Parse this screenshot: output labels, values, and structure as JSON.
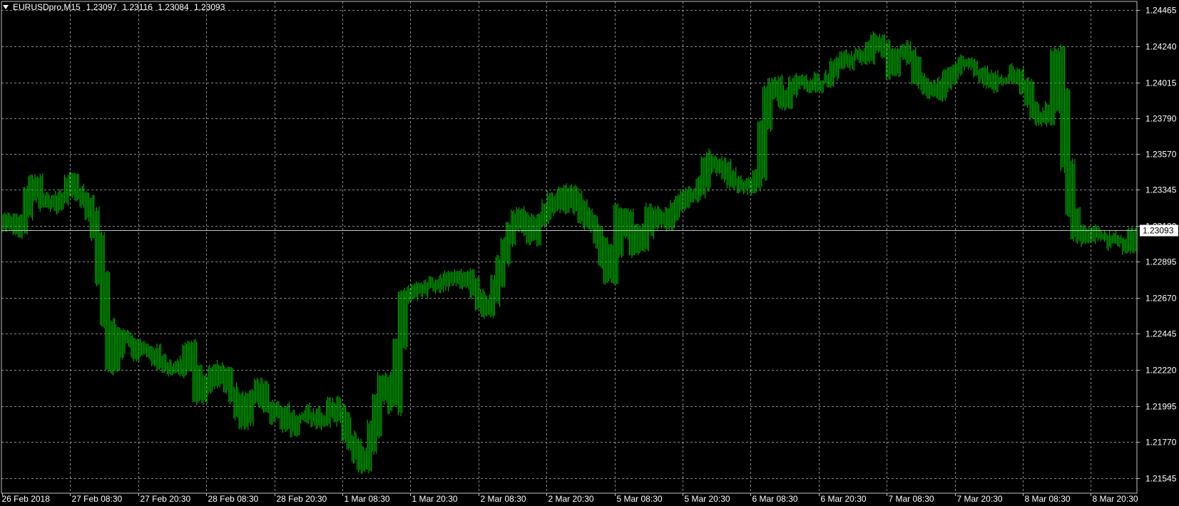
{
  "header": {
    "symbol": "EURUSDpro,M15",
    "open": "1.23097",
    "high": "1.23116",
    "low": "1.23084",
    "close": "1.23093"
  },
  "colors": {
    "background": "#000000",
    "grid": "#c0c0c0",
    "bars": "#00c000",
    "axis_text": "#ffffff",
    "price_line": "#c0c0c0",
    "price_label_bg": "#ffffff",
    "price_label_text": "#000000"
  },
  "chart_data": {
    "type": "line",
    "style": "ohlc-bars",
    "symbol": "EURUSDpro",
    "timeframe": "M15",
    "grid": true,
    "ylim": [
      1.2145,
      1.2452
    ],
    "y_ticks": [
      "1.24465",
      "1.24240",
      "1.24015",
      "1.23790",
      "1.23570",
      "1.23345",
      "1.23120",
      "1.22895",
      "1.22670",
      "1.22445",
      "1.22220",
      "1.21995",
      "1.21770",
      "1.21545"
    ],
    "x_ticks": [
      "26 Feb 2018",
      "27 Feb 08:30",
      "27 Feb 20:30",
      "28 Feb 08:30",
      "28 Feb 20:30",
      "1 Mar 08:30",
      "1 Mar 20:30",
      "2 Mar 08:30",
      "2 Mar 20:30",
      "5 Mar 08:30",
      "5 Mar 20:30",
      "6 Mar 08:30",
      "6 Mar 20:30",
      "7 Mar 08:30",
      "7 Mar 20:30",
      "8 Mar 08:30",
      "8 Mar 20:30"
    ],
    "current_price": 1.23093,
    "current_price_label": "1.23093",
    "series": [
      {
        "values": [
          1.2312,
          1.2316,
          1.2312,
          1.231,
          1.2318,
          1.2335,
          1.234,
          1.233,
          1.2325,
          1.2328,
          1.2325,
          1.233,
          1.2333,
          1.234,
          1.2335,
          1.233,
          1.2328,
          1.2318,
          1.2305,
          1.228,
          1.225,
          1.2225,
          1.2232,
          1.2245,
          1.224,
          1.2238,
          1.2234,
          1.2236,
          1.2235,
          1.2232,
          1.2228,
          1.2226,
          1.2225,
          1.2224,
          1.2222,
          1.2228,
          1.2235,
          1.2222,
          1.2205,
          1.221,
          1.2218,
          1.2222,
          1.2215,
          1.222,
          1.221,
          1.2205,
          1.2195,
          1.219,
          1.2203,
          1.2208,
          1.2212,
          1.22,
          1.2198,
          1.2192,
          1.2195,
          1.2188,
          1.2185,
          1.2192,
          1.219,
          1.2193,
          1.2195,
          1.219,
          1.2193,
          1.2192,
          1.22,
          1.2195,
          1.219,
          1.218,
          1.2175,
          1.2168,
          1.216,
          1.2172,
          1.2185,
          1.2205,
          1.2215,
          1.2215,
          1.22,
          1.224,
          1.2268,
          1.2272,
          1.227,
          1.2272,
          1.2275,
          1.2273,
          1.2275,
          1.2275,
          1.2278,
          1.2278,
          1.228,
          1.2278,
          1.2282,
          1.2275,
          1.227,
          1.2262,
          1.2258,
          1.2265,
          1.2278,
          1.229,
          1.23,
          1.231,
          1.232,
          1.2315,
          1.231,
          1.2305,
          1.2315,
          1.2318,
          1.2322,
          1.2328,
          1.233,
          1.2325,
          1.2335,
          1.233,
          1.2325,
          1.2318,
          1.2315,
          1.231,
          1.2302,
          1.229,
          1.228,
          1.2298,
          1.232,
          1.232,
          1.2308,
          1.2298,
          1.23,
          1.2308,
          1.2322,
          1.2318,
          1.2315,
          1.2315,
          1.232,
          1.2325,
          1.2327,
          1.233,
          1.2332,
          1.2332,
          1.2338,
          1.2355,
          1.2352,
          1.235,
          1.2348,
          1.2345,
          1.234,
          1.2338,
          1.2335,
          1.2335,
          1.2338,
          1.2345,
          1.2375,
          1.2395,
          1.24,
          1.2395,
          1.239,
          1.2395,
          1.24,
          1.2403,
          1.24,
          1.2398,
          1.24,
          1.2402,
          1.2402,
          1.2405,
          1.2412,
          1.2415,
          1.2415,
          1.2417,
          1.2418,
          1.2418,
          1.2418,
          1.2422,
          1.2428,
          1.2425,
          1.2418,
          1.2408,
          1.242,
          1.2422,
          1.242,
          1.2415,
          1.2405,
          1.24,
          1.2398,
          1.2395,
          1.2395,
          1.24,
          1.2405,
          1.2408,
          1.2412,
          1.2413,
          1.2412,
          1.241,
          1.2408,
          1.2405,
          1.24,
          1.2402,
          1.2403,
          1.2403,
          1.2404,
          1.2407,
          1.2403,
          1.2398,
          1.2388,
          1.2382,
          1.2378,
          1.238,
          1.2385,
          1.242,
          1.2395,
          1.235,
          1.232,
          1.2308,
          1.2305,
          1.2305,
          1.2308,
          1.2306,
          1.2305,
          1.2305,
          1.2302,
          1.2304,
          1.2303,
          1.23,
          1.2308
        ]
      }
    ]
  }
}
